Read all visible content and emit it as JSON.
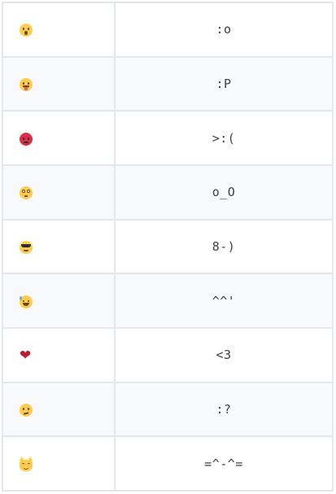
{
  "rows": [
    {
      "icon": "astonished-face-icon",
      "code": ":o"
    },
    {
      "icon": "tongue-out-face-icon",
      "code": ":P"
    },
    {
      "icon": "angry-face-icon",
      "code": ">:("
    },
    {
      "icon": "flushed-face-icon",
      "code": "o_O"
    },
    {
      "icon": "sunglasses-face-icon",
      "code": "8-)"
    },
    {
      "icon": "sweat-smile-face-icon",
      "code": "^^'"
    },
    {
      "icon": "red-heart-icon",
      "code": "<3"
    },
    {
      "icon": "confused-face-icon",
      "code": ":?"
    },
    {
      "icon": "smiling-cat-face-icon",
      "code": "=^-^="
    }
  ],
  "colors": {
    "border": "#e4e8ec",
    "stripe": "#f8f9fa",
    "text": "#3c4248",
    "emoji_yellow": "#ffcc4d",
    "emoji_red": "#da2f47",
    "heart_red": "#be1931"
  }
}
